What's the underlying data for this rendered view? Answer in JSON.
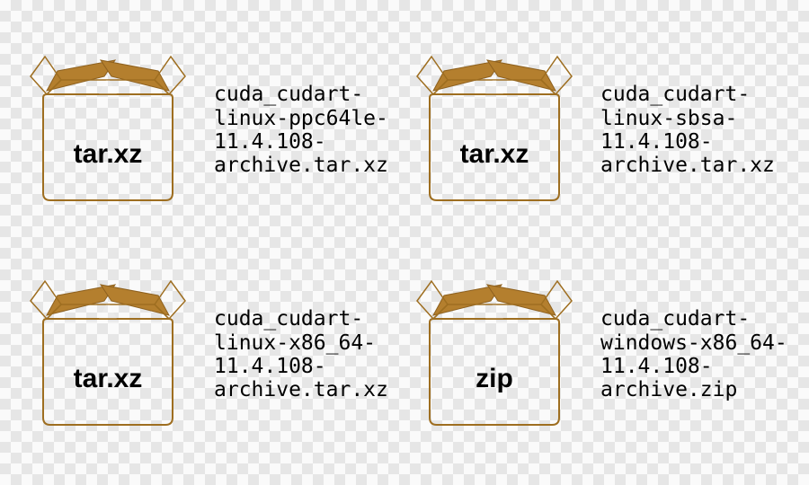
{
  "files": [
    {
      "archive_type": "tar.xz",
      "name": "cuda_cudart-\nlinux-ppc64le-\n11.4.108-\narchive.tar.xz"
    },
    {
      "archive_type": "tar.xz",
      "name": "cuda_cudart-\nlinux-sbsa-\n11.4.108-\narchive.tar.xz"
    },
    {
      "archive_type": "tar.xz",
      "name": "cuda_cudart-\nlinux-x86_64-\n11.4.108-\narchive.tar.xz"
    },
    {
      "archive_type": "zip",
      "name": "cuda_cudart-\nwindows-x86_64-\n11.4.108-\narchive.zip"
    }
  ]
}
